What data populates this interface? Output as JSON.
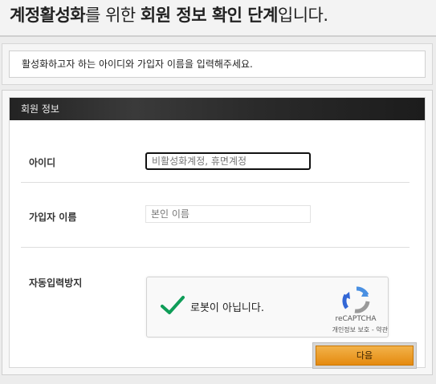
{
  "header": {
    "title_part1": "계정활성화",
    "title_part2": "를 위한 ",
    "title_part3": "회원 정보 확인 단계",
    "title_part4": "입니다."
  },
  "notice": {
    "text": "활성화하고자 하는 아이디와 가입자 이름을 입력해주세요."
  },
  "form": {
    "section_title": "회원 정보",
    "id_label": "아이디",
    "id_placeholder": "비활성화계정, 휴면계정",
    "name_label": "가입자 이름",
    "name_placeholder": "본인 이름",
    "captcha_label": "자동입력방지"
  },
  "captcha": {
    "checkbox_label": "로봇이 아닙니다.",
    "brand": "reCAPTCHA",
    "privacy": "개인정보 보호",
    "separator": " - ",
    "terms": "약관",
    "checked": true
  },
  "actions": {
    "next_label": "다음"
  },
  "colors": {
    "accent_orange": "#e8961f",
    "check_green": "#0f9d58",
    "header_dark": "#2a2a2a"
  }
}
